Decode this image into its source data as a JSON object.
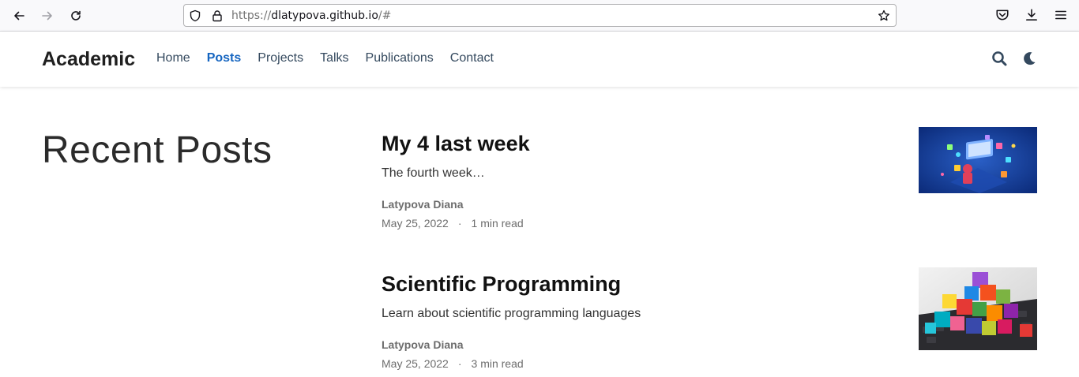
{
  "browser": {
    "url_prefix": "https://",
    "url_domain": "dlatypova.github.io",
    "url_suffix": "/#"
  },
  "header": {
    "brand": "Academic",
    "menu": [
      {
        "label": "Home"
      },
      {
        "label": "Posts"
      },
      {
        "label": "Projects"
      },
      {
        "label": "Talks"
      },
      {
        "label": "Publications"
      },
      {
        "label": "Contact"
      }
    ],
    "active_item": "Posts",
    "accent_color": "#1565c0"
  },
  "main": {
    "section_title": "Recent Posts",
    "posts": [
      {
        "title": "My 4 last week",
        "summary": "The fourth week…",
        "author": "Latypova Diana",
        "date": "May 25, 2022",
        "separator": "·",
        "reading_time": "1 min read"
      },
      {
        "title": "Scientific Programming",
        "summary": "Learn about scientific programming languages",
        "author": "Latypova Diana",
        "date": "May 25, 2022",
        "separator": "·",
        "reading_time": "3 min read"
      }
    ]
  },
  "icons": {
    "back": "arrow-left-icon",
    "forward": "arrow-right-icon",
    "reload": "reload-icon",
    "shield": "shield-icon",
    "lock": "lock-icon",
    "bookmark": "star-icon",
    "pocket": "pocket-icon",
    "download": "download-icon",
    "menu": "hamburger-menu-icon",
    "search": "search-icon",
    "theme": "moon-icon"
  }
}
